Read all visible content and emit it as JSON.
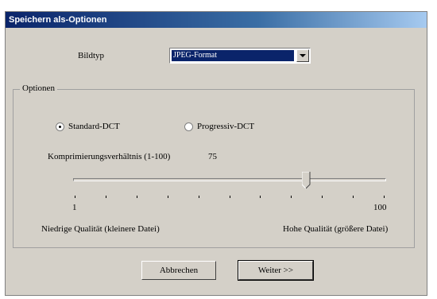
{
  "window": {
    "title": "Speichern als-Optionen"
  },
  "image_type": {
    "label": "Bildtyp",
    "selected": "JPEG-Format",
    "icon": "chevron-down-icon"
  },
  "options": {
    "group_label": "Optionen",
    "radios": [
      {
        "label": "Standard-DCT",
        "checked": true
      },
      {
        "label": "Progressiv-DCT",
        "checked": false
      }
    ],
    "compression": {
      "label": "Komprimierungsverhältnis (1-100)",
      "value": "75",
      "value_num": 75,
      "min": 1,
      "max": 100,
      "min_label": "1",
      "max_label": "100",
      "left_caption": "Niedrige Qualität (kleinere Datei)",
      "right_caption": "Hohe Qualität (größere Datei)",
      "tick_count": 11
    }
  },
  "buttons": {
    "cancel": "Abbrechen",
    "next": "Weiter >>"
  }
}
